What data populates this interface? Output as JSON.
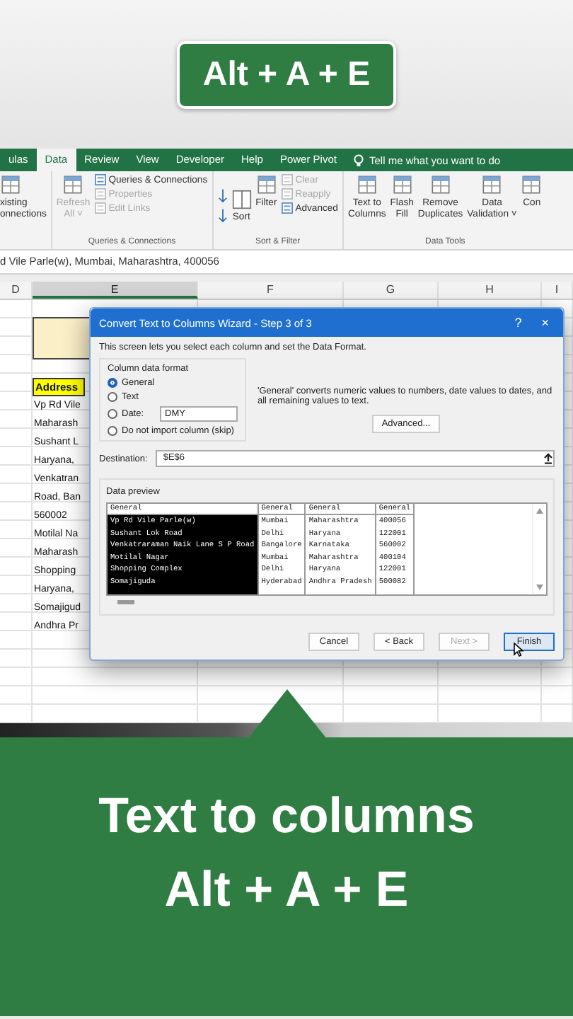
{
  "banner": {
    "text": "Alt + A + E"
  },
  "ribbon": {
    "tabs": [
      {
        "label": "ulas",
        "selected": false
      },
      {
        "label": "Data",
        "selected": true
      },
      {
        "label": "Review",
        "selected": false
      },
      {
        "label": "View",
        "selected": false
      },
      {
        "label": "Developer",
        "selected": false
      },
      {
        "label": "Help",
        "selected": false
      },
      {
        "label": "Power Pivot",
        "selected": false
      }
    ],
    "tell_me": "Tell me what you want to do",
    "groups": [
      {
        "items": [
          {
            "kind": "large",
            "label": "xisting\nonnections",
            "disabled": false
          }
        ]
      },
      {
        "label": "Queries & Connections",
        "items": [
          {
            "kind": "large",
            "label": "Refresh\nAll ˅",
            "disabled": true
          },
          {
            "kind": "small",
            "label": "Queries & Connections",
            "disabled": false
          },
          {
            "kind": "small",
            "label": "Properties",
            "disabled": true
          },
          {
            "kind": "small",
            "label": "Edit Links",
            "disabled": true
          }
        ]
      },
      {
        "label": "Sort & Filter",
        "items": [
          {
            "kind": "sort",
            "label": "Sort",
            "disabled": false
          },
          {
            "kind": "large",
            "label": "Filter",
            "disabled": false
          },
          {
            "kind": "small",
            "label": "Clear",
            "disabled": true
          },
          {
            "kind": "small",
            "label": "Reapply",
            "disabled": true
          },
          {
            "kind": "small",
            "label": "Advanced",
            "disabled": false
          }
        ]
      },
      {
        "label": "Data Tools",
        "items": [
          {
            "kind": "large",
            "label": "Text to\nColumns",
            "disabled": false
          },
          {
            "kind": "large",
            "label": "Flash\nFill",
            "disabled": false
          },
          {
            "kind": "large",
            "label": "Remove\nDuplicates",
            "disabled": false
          },
          {
            "kind": "large",
            "label": "Data\nValidation ˅",
            "disabled": false
          },
          {
            "kind": "large",
            "label": "Con",
            "disabled": false
          }
        ]
      }
    ]
  },
  "formula_bar": {
    "value": "d Vile Parle(w), Mumbai, Maharashtra, 400056"
  },
  "sheet": {
    "columns": [
      {
        "label": "D",
        "selected": false
      },
      {
        "label": "E",
        "selected": true
      },
      {
        "label": "F",
        "selected": false
      },
      {
        "label": "G",
        "selected": false
      },
      {
        "label": "H",
        "selected": false
      },
      {
        "label": "I",
        "selected": false
      }
    ],
    "header": "Address",
    "cells": [
      "Vp Rd Vile",
      "Maharash",
      "Sushant L",
      "Haryana,",
      "Venkatran",
      "Road, Ban",
      "560002",
      "Motilal Na",
      "Maharash",
      "Shopping",
      "Haryana,",
      "Somajigud",
      "Andhra Pr"
    ]
  },
  "dialog": {
    "title": "Convert Text to Columns Wizard - Step 3 of 3",
    "help": "?",
    "close": "×",
    "intro": "This screen lets you select each column and set the Data Format.",
    "format_legend": "Column data format",
    "formats": [
      {
        "kind": "plain",
        "label": "General",
        "selected": true
      },
      {
        "kind": "plain",
        "label": "Text",
        "selected": false
      },
      {
        "kind": "date",
        "label": "Date:",
        "selected": false,
        "value": "DMY"
      },
      {
        "kind": "plain",
        "label": "Do not import column (skip)",
        "selected": false
      }
    ],
    "description": "'General' converts numeric values to numbers, date values to dates, and all remaining values to text.",
    "advanced": "Advanced...",
    "destination_label": "Destination:",
    "destination": "$E$6",
    "preview_label": "Data preview",
    "preview": {
      "columns": [
        {
          "header": "General",
          "selected": true
        },
        {
          "header": "General",
          "selected": false
        },
        {
          "header": "General",
          "selected": false
        },
        {
          "header": "General",
          "selected": false
        }
      ],
      "rows": [
        [
          "Vp Rd Vile Parle(w)",
          "Mumbai",
          "Maharashtra",
          "400056"
        ],
        [
          "Sushant Lok Road",
          "Delhi",
          "Haryana",
          "122001"
        ],
        [
          "Venkatraraman Naik Lane S P Road",
          "Bangalore",
          "Karnataka",
          "560002"
        ],
        [
          "Motilal Nagar",
          "Mumbai",
          "Maharashtra",
          "400104"
        ],
        [
          "Shopping Complex",
          "Delhi",
          "Haryana",
          "122001"
        ],
        [
          "Somajiguda",
          "Hyderabad",
          "Andhra Pradesh",
          "500082"
        ]
      ]
    },
    "buttons": [
      {
        "label": "Cancel",
        "disabled": false,
        "default": false
      },
      {
        "label": "< Back",
        "disabled": false,
        "default": false
      },
      {
        "label": "Next >",
        "disabled": true,
        "default": false
      },
      {
        "label": "Finish",
        "disabled": false,
        "default": true
      }
    ]
  },
  "caption": {
    "title": "Text to columns",
    "shortcut": "Alt + A + E"
  }
}
